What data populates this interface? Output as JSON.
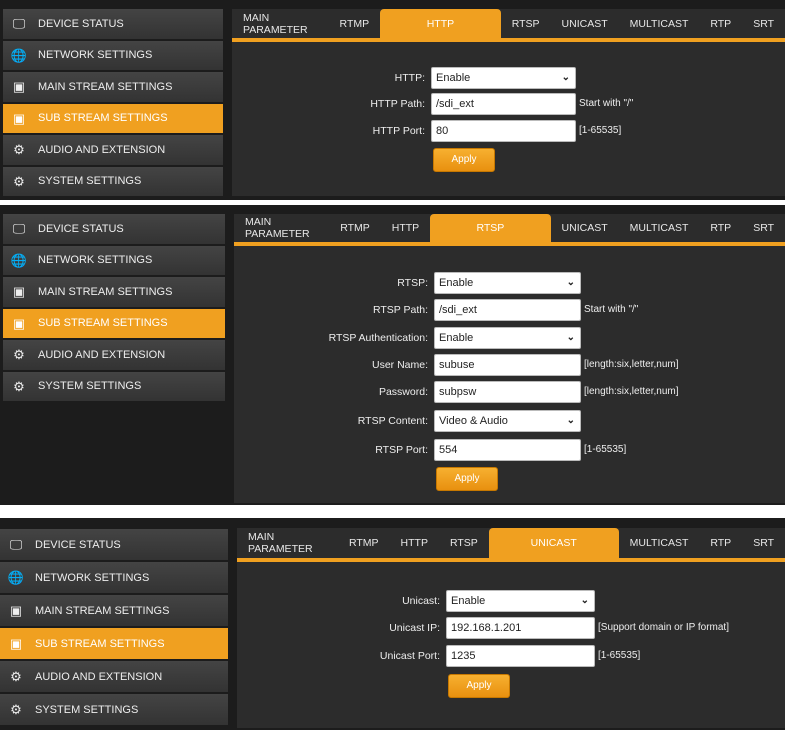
{
  "sidebar_items": [
    {
      "label": "DEVICE STATUS",
      "icon": "monitor-icon"
    },
    {
      "label": "NETWORK SETTINGS",
      "icon": "globe-icon"
    },
    {
      "label": "MAIN STREAM SETTINGS",
      "icon": "stream-icon"
    },
    {
      "label": "SUB STREAM SETTINGS",
      "icon": "stream-icon",
      "active": true
    },
    {
      "label": "AUDIO AND EXTENSION",
      "icon": "audio-extension-icon"
    },
    {
      "label": "SYSTEM SETTINGS",
      "icon": "gear-icon"
    }
  ],
  "tabs": [
    "MAIN PARAMETER",
    "RTMP",
    "HTTP",
    "RTSP",
    "UNICAST",
    "MULTICAST",
    "RTP",
    "SRT"
  ],
  "accent": "#f0a020",
  "panels": [
    {
      "active_tab": 2,
      "apply_label": "Apply",
      "fields": [
        {
          "label": "HTTP:",
          "value": "Enable",
          "type": "select",
          "hint": ""
        },
        {
          "label": "HTTP Path:",
          "value": "/sdi_ext",
          "type": "text",
          "hint": "Start with \"/\""
        },
        {
          "label": "HTTP Port:",
          "value": "80",
          "type": "text",
          "hint": "[1-65535]"
        }
      ]
    },
    {
      "active_tab": 3,
      "apply_label": "Apply",
      "fields": [
        {
          "label": "RTSP:",
          "value": "Enable",
          "type": "select",
          "hint": ""
        },
        {
          "label": "RTSP Path:",
          "value": "/sdi_ext",
          "type": "text",
          "hint": "Start with \"/\""
        },
        {
          "label": "RTSP Authentication:",
          "value": "Enable",
          "type": "select",
          "hint": ""
        },
        {
          "label": "User Name:",
          "value": "subuse",
          "type": "text",
          "hint": "[length:six,letter,num]"
        },
        {
          "label": "Password:",
          "value": "subpsw",
          "type": "text",
          "hint": "[length:six,letter,num]"
        },
        {
          "label": "RTSP Content:",
          "value": "Video & Audio",
          "type": "select",
          "hint": ""
        },
        {
          "label": "RTSP Port:",
          "value": "554",
          "type": "text",
          "hint": "[1-65535]"
        }
      ]
    },
    {
      "active_tab": 4,
      "apply_label": "Apply",
      "fields": [
        {
          "label": "Unicast:",
          "value": "Enable",
          "type": "select",
          "hint": ""
        },
        {
          "label": "Unicast IP:",
          "value": "192.168.1.201",
          "type": "text",
          "hint": "[Support domain or IP format]"
        },
        {
          "label": "Unicast Port:",
          "value": "1235",
          "type": "text",
          "hint": "[1-65535]"
        }
      ]
    }
  ]
}
